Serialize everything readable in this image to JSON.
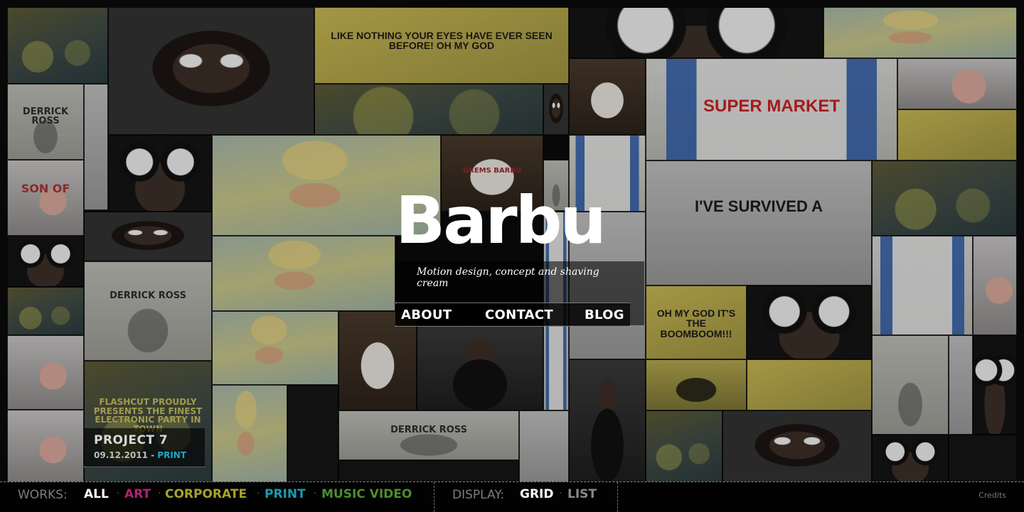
{
  "brand": {
    "logo": "Barbu",
    "tagline": "Motion design, concept and shaving cream"
  },
  "nav": {
    "about": "ABOUT",
    "contact": "CONTACT",
    "blog": "BLOG"
  },
  "project": {
    "title": "PROJECT 7",
    "date": "09.12.2011",
    "separator": "-",
    "category": "PRINT"
  },
  "tiles_text": {
    "poster_top": "LIKE NOTHING YOUR EYES HAVE EVER SEEN BEFORE! OH MY GOD",
    "poster_flashcut": "FLASHCUT PROUDLY PRESENTS THE FINEST ELECTRONIC PARTY IN TOWN",
    "derrick": "DERRICK ROSS",
    "son": "SON OF",
    "survived": "I'VE SURVIVED A",
    "supermarket": "SUPER MARKET",
    "boom": "OH MY GOD IT'S THE BOOMBOOM!!!",
    "shirt": "GREMS BARBU"
  },
  "footer": {
    "works_label": "WORKS:",
    "filters": [
      {
        "label": "ALL",
        "color": "#ffffff"
      },
      {
        "label": "ART",
        "color": "#b0246e"
      },
      {
        "label": "CORPORATE",
        "color": "#a8a32a"
      },
      {
        "label": "PRINT",
        "color": "#1a9ab2"
      },
      {
        "label": "MUSIC VIDEO",
        "color": "#4d8d2e"
      }
    ],
    "display_label": "DISPLAY:",
    "display_options": [
      {
        "label": "GRID",
        "color": "#ffffff"
      },
      {
        "label": "LIST",
        "color": "#8a8a8a"
      }
    ],
    "credits": "Credits"
  },
  "colors": {
    "accent_print": "#19a8c8",
    "accent_art": "#b0246e",
    "accent_corporate": "#a8a32a",
    "accent_music": "#4d8d2e"
  }
}
